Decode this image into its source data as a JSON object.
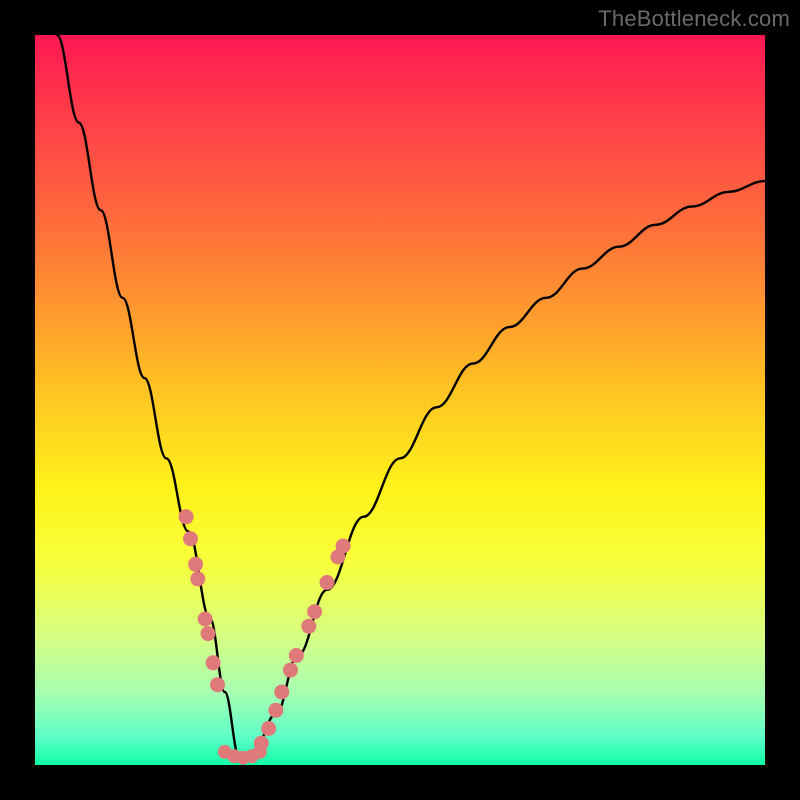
{
  "watermark": "TheBottleneck.com",
  "colors": {
    "background": "#000000",
    "curve": "#000000",
    "dots": "#e07a7a",
    "gradient_top": "#ff1854",
    "gradient_bottom": "#10ffa8"
  },
  "chart_data": {
    "type": "line",
    "title": "",
    "xlabel": "",
    "ylabel": "",
    "xlim": [
      0,
      100
    ],
    "ylim": [
      0,
      100
    ],
    "description": "Bottleneck curve: V-shaped profile with minimum near x≈28 on a 0–100 axis. Background gradient encodes bottleneck severity (red=high at top, green=low at bottom). Salmon dots cluster along the curve near the minimum region.",
    "series": [
      {
        "name": "bottleneck_curve",
        "x": [
          3,
          6,
          9,
          12,
          15,
          18,
          21,
          24,
          26,
          28,
          30,
          33,
          36,
          40,
          45,
          50,
          55,
          60,
          65,
          70,
          75,
          80,
          85,
          90,
          95,
          100
        ],
        "y": [
          100,
          88,
          76,
          64,
          53,
          42,
          32,
          20,
          10,
          1,
          2,
          7,
          15,
          24,
          34,
          42,
          49,
          55,
          60,
          64,
          68,
          71,
          74,
          76.5,
          78.5,
          80
        ]
      }
    ],
    "dots_left": [
      {
        "x": 20.7,
        "y": 34.0
      },
      {
        "x": 21.3,
        "y": 31.0
      },
      {
        "x": 22.0,
        "y": 27.5
      },
      {
        "x": 22.3,
        "y": 25.5
      },
      {
        "x": 23.3,
        "y": 20.0
      },
      {
        "x": 23.7,
        "y": 18.0
      },
      {
        "x": 24.4,
        "y": 14.0
      },
      {
        "x": 25.0,
        "y": 11.0
      }
    ],
    "dots_right": [
      {
        "x": 31.0,
        "y": 3.0
      },
      {
        "x": 32.0,
        "y": 5.0
      },
      {
        "x": 33.0,
        "y": 7.5
      },
      {
        "x": 33.8,
        "y": 10.0
      },
      {
        "x": 35.0,
        "y": 13.0
      },
      {
        "x": 35.8,
        "y": 15.0
      },
      {
        "x": 37.5,
        "y": 19.0
      },
      {
        "x": 38.3,
        "y": 21.0
      },
      {
        "x": 40.0,
        "y": 25.0
      },
      {
        "x": 41.5,
        "y": 28.5
      },
      {
        "x": 42.2,
        "y": 30.0
      }
    ],
    "dots_bottom": [
      {
        "x": 26.0,
        "y": 1.8
      },
      {
        "x": 27.3,
        "y": 1.2
      },
      {
        "x": 28.5,
        "y": 1.0
      },
      {
        "x": 29.7,
        "y": 1.2
      },
      {
        "x": 30.8,
        "y": 1.8
      }
    ]
  }
}
